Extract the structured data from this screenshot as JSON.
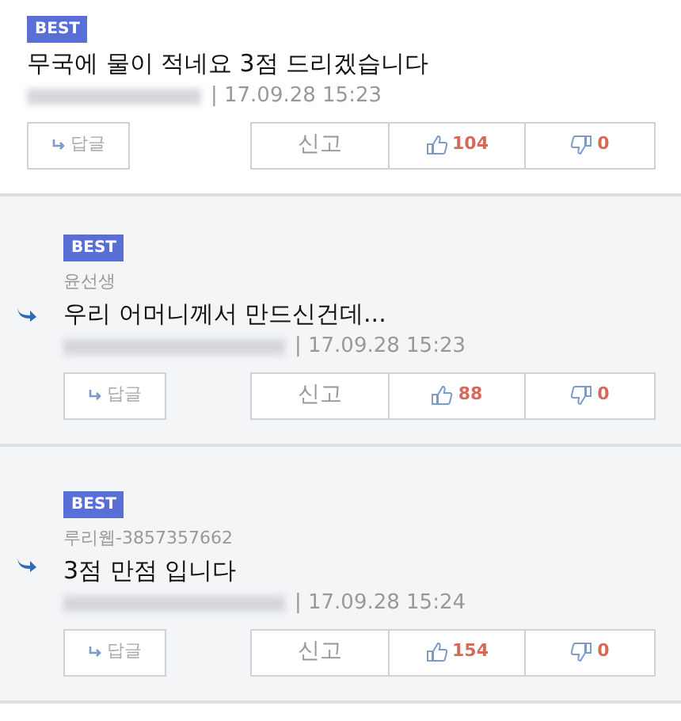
{
  "comments": [
    {
      "kind": "comment",
      "badge": "BEST",
      "text": "무국에 물이 적네요 3점 드리겠습니다",
      "date": "| 17.09.28 15:23",
      "reply_button": "답글",
      "report_button": "신고",
      "likes": "104",
      "dislikes": "0"
    },
    {
      "kind": "reply",
      "badge": "BEST",
      "reply_to": "윤선생",
      "text": "우리 어머니께서 만드신건데...",
      "date": "| 17.09.28 15:23",
      "reply_button": "답글",
      "report_button": "신고",
      "likes": "88",
      "dislikes": "0"
    },
    {
      "kind": "reply",
      "badge": "BEST",
      "reply_to": "루리웹-3857357662",
      "text": "3점 만점 입니다",
      "date": "| 17.09.28 15:24",
      "reply_button": "답글",
      "report_button": "신고",
      "likes": "154",
      "dislikes": "0"
    }
  ]
}
